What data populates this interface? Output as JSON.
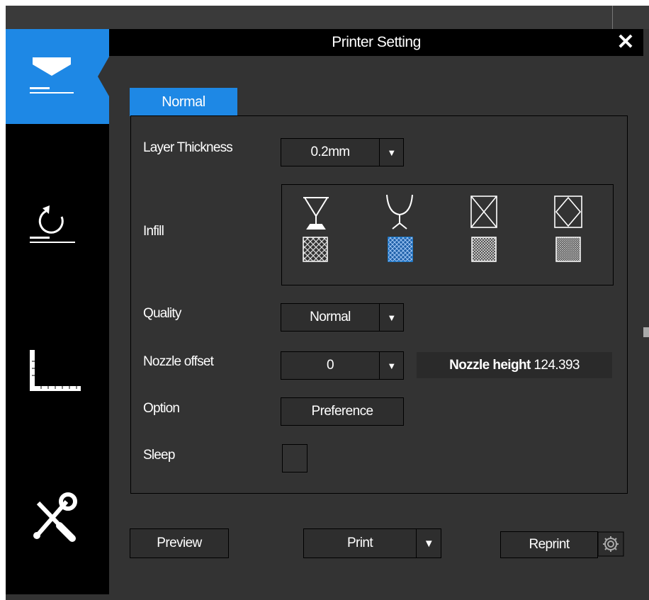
{
  "dialog": {
    "title": "Printer Setting",
    "close_symbol": "✕"
  },
  "sidebar": {
    "items": [
      {
        "icon": "print-icon",
        "active": true
      },
      {
        "icon": "rotate-icon",
        "active": false
      },
      {
        "icon": "ruler-icon",
        "active": false
      },
      {
        "icon": "tools-icon",
        "active": false
      }
    ],
    "accent": "#1e88e5"
  },
  "tabs": [
    {
      "label": "Normal",
      "active": true
    }
  ],
  "settings": {
    "layer_thickness": {
      "label": "Layer Thickness",
      "value": "0.2mm",
      "arrow": "▼"
    },
    "infill": {
      "label": "Infill",
      "shapes": [
        "goblet-icon",
        "open-goblet-icon",
        "cross-square-icon",
        "diamond-square-icon"
      ],
      "patterns": [
        "hatch-coarse",
        "hatch-medium",
        "hatch-fine",
        "hatch-finest"
      ],
      "selected_pattern_index": 1
    },
    "quality": {
      "label": "Quality",
      "value": "Normal",
      "arrow": "▼"
    },
    "nozzle_offset": {
      "label": "Nozzle offset",
      "value": "0",
      "arrow": "▼"
    },
    "nozzle_height": {
      "label": "Nozzle height",
      "value": "124.393"
    },
    "option": {
      "label": "Option",
      "button": "Preference"
    },
    "sleep": {
      "label": "Sleep",
      "checked": false
    }
  },
  "footer": {
    "preview": "Preview",
    "print": "Print",
    "print_arrow": "▼",
    "reprint": "Reprint",
    "reprint_icon": "gear-icon"
  }
}
